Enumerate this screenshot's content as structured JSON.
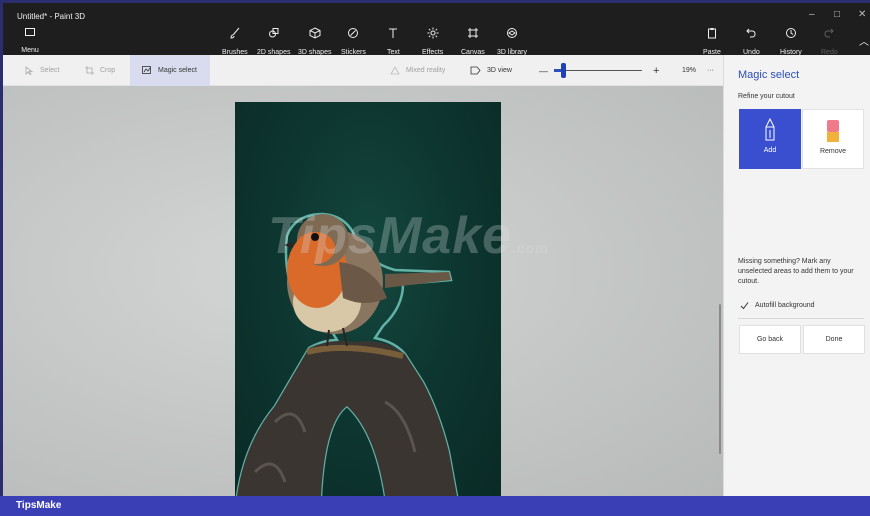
{
  "window": {
    "title": "Untitled* - Paint 3D",
    "minimize_glyph": "–",
    "maximize_glyph": "□",
    "close_glyph": "✕"
  },
  "ribbon": {
    "menu_label": "Menu",
    "tools": [
      {
        "label": "Brushes",
        "icon": "brush-icon"
      },
      {
        "label": "2D shapes",
        "icon": "2d-shapes-icon"
      },
      {
        "label": "3D shapes",
        "icon": "3d-shapes-icon"
      },
      {
        "label": "Stickers",
        "icon": "stickers-icon"
      },
      {
        "label": "Text",
        "icon": "text-icon"
      },
      {
        "label": "Effects",
        "icon": "effects-icon"
      },
      {
        "label": "Canvas",
        "icon": "canvas-icon"
      },
      {
        "label": "3D library",
        "icon": "3d-library-icon"
      }
    ],
    "paste_label": "Paste",
    "undo_label": "Undo",
    "history_label": "History",
    "redo_label": "Redo",
    "collapse_glyph": "︿"
  },
  "commandbar": {
    "select_label": "Select",
    "crop_label": "Crop",
    "magic_select_label": "Magic select",
    "mixed_reality_label": "Mixed reality",
    "view_3d_label": "3D view",
    "zoom_minus": "—",
    "zoom_plus": "+",
    "zoom_value": "19%",
    "zoom_fraction": 0.1,
    "more_glyph": "···"
  },
  "canvas": {
    "watermark_main": "TipsMake",
    "watermark_suffix": ".com"
  },
  "panel": {
    "title": "Magic select",
    "refine_label": "Refine your cutout",
    "add_label": "Add",
    "remove_label": "Remove",
    "missing_text": "Missing something? Mark any unselected areas to add them to your cutout.",
    "autofill_label": "Autofill background",
    "autofill_checked": true,
    "go_back_label": "Go back",
    "done_label": "Done"
  },
  "footer": {
    "brand": "TipsMake"
  },
  "colors": {
    "accent": "#3a4fd0",
    "panel_title": "#2d4fb5",
    "brand_bar": "#3b3fb6"
  }
}
